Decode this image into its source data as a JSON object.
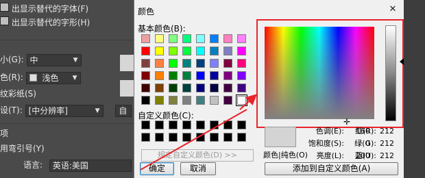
{
  "background_panel": {
    "rows": [
      {
        "text": "出显示替代的字体(F)",
        "checkbox": true
      },
      {
        "text": "出显示替代的字形(H)",
        "checkbox": true
      }
    ],
    "size_label": "小(G):",
    "size_value": "中",
    "color_label": "色(R):",
    "color_value": "浅色",
    "wallpaper_label": "纹彩纸(S)",
    "preset_label": "设(T):",
    "preset_value": "[中分辨率]",
    "custom_button": "自",
    "options_heading": "项",
    "quotes_label": "用弯引号(Y)",
    "language_label": "语言:",
    "language_value": "英语:美国"
  },
  "dialog": {
    "title": "颜色",
    "close_glyph": "✕",
    "basic_colors_label": "基本颜色(B):",
    "basic_colors": [
      [
        "#e8a0a0",
        "#ffff80",
        "#80ff80",
        "#00ff80",
        "#80ffff",
        "#0080ff",
        "#ff80c0",
        "#ff80ff"
      ],
      [
        "#ff0000",
        "#ffff00",
        "#80ff00",
        "#00ff40",
        "#00ffff",
        "#0080c0",
        "#8080c0",
        "#ff00ff"
      ],
      [
        "#804040",
        "#ff8040",
        "#00ff00",
        "#008080",
        "#004080",
        "#8080ff",
        "#800040",
        "#ff0080"
      ],
      [
        "#800000",
        "#ff8000",
        "#008000",
        "#008040",
        "#0000ff",
        "#0000a0",
        "#800080",
        "#8000ff"
      ],
      [
        "#400000",
        "#804000",
        "#004000",
        "#004040",
        "#000080",
        "#000040",
        "#400040",
        "#400080"
      ],
      [
        "#000000",
        "#808000",
        "#808040",
        "#808080",
        "#408080",
        "#c0c0c0",
        "#400040",
        "#ffffff"
      ]
    ],
    "custom_colors_label": "自定义颜色(C):",
    "custom_colors": [
      [
        "#000000",
        "#000000",
        "#000000",
        "#000000",
        "#000000",
        "#000000",
        "#000000",
        "#000000"
      ],
      [
        "#000000",
        "#000000",
        "#000000",
        "#000000",
        "#000000",
        "#000000",
        "#000000",
        "#000000"
      ]
    ],
    "define_custom_button": "规定自定义颜色(D) >>",
    "ok_button": "确定",
    "cancel_button": "取消",
    "preview_label": "颜色|纯色(O)",
    "hue_label": "色调(E):",
    "hue_value": "160",
    "sat_label": "饱和度(S):",
    "sat_value": "0",
    "lum_label": "亮度(L):",
    "lum_value": "200",
    "red_label": "红(R):",
    "red_value": "212",
    "green_label": "绿(G):",
    "green_value": "212",
    "blue_label": "蓝(U):",
    "blue_value": "212",
    "add_custom_button": "添加到自定义颜色(A)",
    "crosshair_glyph": "✛"
  },
  "annotation_color": "#e8242a"
}
